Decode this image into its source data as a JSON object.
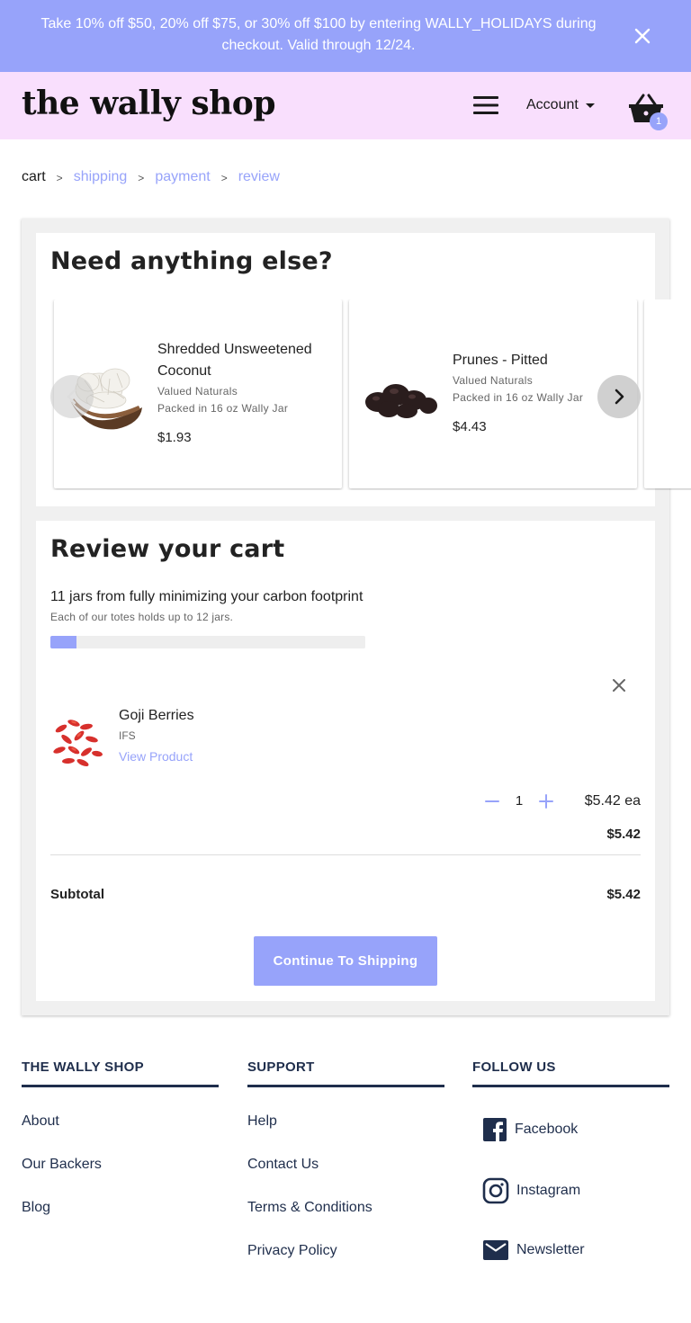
{
  "promo": {
    "text": "Take 10% off $50, 20% off $75, or 30% off $100 by entering WALLY_HOLIDAYS during checkout. Valid through 12/24.",
    "close_icon": "close-icon"
  },
  "header": {
    "logo": "the wally shop",
    "account_label": "Account",
    "cart_count": "1",
    "colors": {
      "banner": "#97a3fa",
      "header_bg": "#f9dffd",
      "accent": "#97a3fa"
    }
  },
  "breadcrumb": {
    "items": [
      "cart",
      "shipping",
      "payment",
      "review"
    ],
    "separator": ">"
  },
  "upsell": {
    "title": "Need anything else?",
    "products": [
      {
        "name": "Shredded Unsweetened Coconut",
        "brand": "Valued Naturals",
        "packaging": "Packed in 16 oz Wally Jar",
        "price": "$1.93"
      },
      {
        "name": "Prunes - Pitted",
        "brand": "Valued Naturals",
        "packaging": "Packed in 16 oz Wally Jar",
        "price": "$4.43"
      }
    ]
  },
  "review": {
    "title": "Review your cart",
    "footprint_text": "11 jars from fully minimizing your carbon footprint",
    "footprint_sub": "Each of our totes holds up to 12 jars.",
    "progress_fraction": 0.083,
    "item": {
      "name": "Goji Berries",
      "brand": "IFS",
      "view_label": "View Product",
      "quantity": "1",
      "unit_price": "$5.42 ea",
      "line_total": "$5.42"
    },
    "subtotal_label": "Subtotal",
    "subtotal_value": "$5.42",
    "continue_label": "Continue To Shipping"
  },
  "footer": {
    "col1": {
      "heading": "THE WALLY SHOP",
      "links": [
        "About",
        "Our Backers",
        "Blog"
      ]
    },
    "col2": {
      "heading": "SUPPORT",
      "links": [
        "Help",
        "Contact Us",
        "Terms & Conditions",
        "Privacy Policy"
      ]
    },
    "col3": {
      "heading": "FOLLOW US",
      "links": [
        {
          "label": "Facebook",
          "icon": "facebook-icon"
        },
        {
          "label": "Instagram",
          "icon": "instagram-icon"
        },
        {
          "label": "Newsletter",
          "icon": "mail-icon"
        }
      ]
    }
  }
}
